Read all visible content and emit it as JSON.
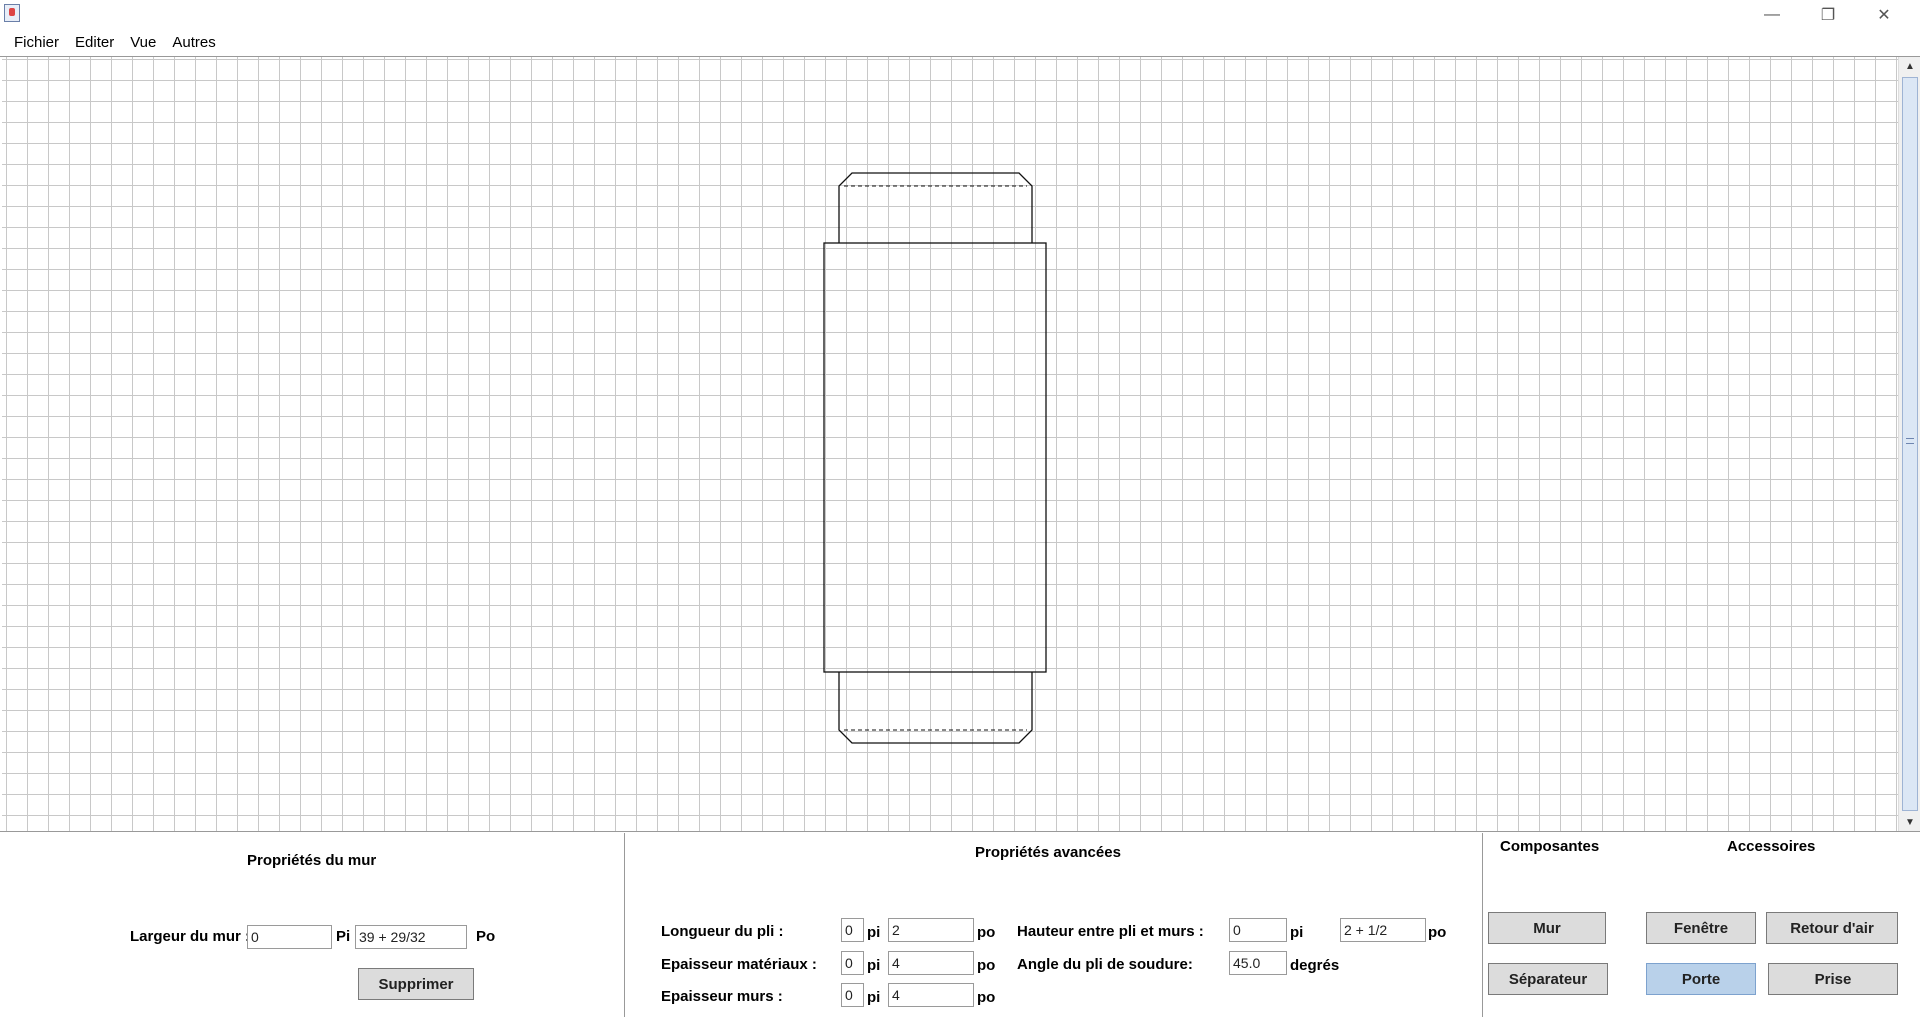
{
  "menu": [
    "Fichier",
    "Editer",
    "Vue",
    "Autres"
  ],
  "wall_panel": {
    "title": "Propriétés du mur",
    "width_label": "Largeur du mur :",
    "width_pi_value": "0",
    "pi_unit": "Pi",
    "width_po_value": "39 + 29/32",
    "po_unit": "Po",
    "delete_label": "Supprimer"
  },
  "advanced_panel": {
    "title": "Propriétés avancées",
    "pli_length_label": "Longueur du pli :",
    "pli_length_pi": "0",
    "pli_length_po": "2",
    "material_thickness_label": "Epaisseur matériaux :",
    "material_thickness_pi": "0",
    "material_thickness_po": "4",
    "wall_thickness_label": "Epaisseur murs :",
    "wall_thickness_pi": "0",
    "wall_thickness_po": "4",
    "height_label": "Hauteur entre pli et murs :",
    "height_pi": "0",
    "height_po": "2 + 1/2",
    "angle_label": "Angle du pli de soudure:",
    "angle_value": "45.0",
    "angle_unit": "degrés",
    "pi_unit": "pi",
    "po_unit": "po"
  },
  "components_panel": {
    "components_title": "Composantes",
    "accessories_title": "Accessoires",
    "buttons": {
      "mur": "Mur",
      "separateur": "Séparateur",
      "fenetre": "Fenêtre",
      "retour_air": "Retour d'air",
      "porte": "Porte",
      "prise": "Prise"
    },
    "active_button": "porte"
  }
}
